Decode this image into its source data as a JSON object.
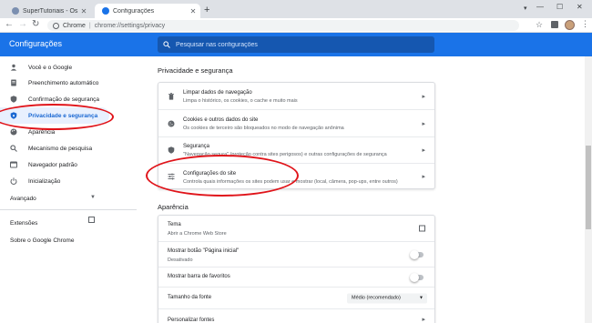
{
  "browser": {
    "tabs": [
      {
        "title": "SuperTutoriais - Os melhores tut",
        "active": false
      },
      {
        "title": "Configurações",
        "active": true
      }
    ],
    "omnibox": {
      "chip": "Chrome",
      "url": "chrome://settings/privacy"
    }
  },
  "header": {
    "title": "Configurações",
    "search_placeholder": "Pesquisar nas configurações"
  },
  "sidebar": {
    "items": [
      {
        "label": "Você e o Google",
        "icon": "person-icon"
      },
      {
        "label": "Preenchimento automático",
        "icon": "document-icon"
      },
      {
        "label": "Confirmação de segurança",
        "icon": "shield-icon"
      },
      {
        "label": "Privacidade e segurança",
        "icon": "shield-lock-icon",
        "selected": true
      },
      {
        "label": "Aparência",
        "icon": "palette-icon"
      },
      {
        "label": "Mecanismo de pesquisa",
        "icon": "search-icon"
      },
      {
        "label": "Navegador padrão",
        "icon": "browser-icon"
      },
      {
        "label": "Inicialização",
        "icon": "power-icon"
      }
    ],
    "advanced": "Avançado",
    "extensions": "Extensões",
    "about": "Sobre o Google Chrome"
  },
  "privacy": {
    "title": "Privacidade e segurança",
    "rows": [
      {
        "title": "Limpar dados de navegação",
        "subtitle": "Limpa o histórico, os cookies, o cache e muito mais",
        "icon": "trash-icon"
      },
      {
        "title": "Cookies e outros dados do site",
        "subtitle": "Os cookies de terceiro são bloqueados no modo de navegação anônima",
        "icon": "cookie-icon"
      },
      {
        "title": "Segurança",
        "subtitle": "\"Navegação segura\" (proteção contra sites perigosos) e outras configurações de segurança",
        "icon": "shield-icon"
      },
      {
        "title": "Configurações do site",
        "subtitle": "Controla quais informações os sites podem usar e mostrar (local, câmera, pop-ups, entre outros)",
        "icon": "tune-icon"
      }
    ]
  },
  "appearance": {
    "title": "Aparência",
    "theme_title": "Tema",
    "theme_subtitle": "Abrir a Chrome Web Store",
    "home_title": "Mostrar botão \"Página inicial\"",
    "home_subtitle": "Desativado",
    "home_on": false,
    "bookmarks_title": "Mostrar barra de favoritos",
    "bookmarks_on": false,
    "font_size_title": "Tamanho da fonte",
    "font_size_value": "Médio (recomendado)",
    "custom_fonts_title": "Personalizar fontes"
  },
  "colors": {
    "accent": "#1a73e8",
    "annotation": "#e0141a"
  }
}
